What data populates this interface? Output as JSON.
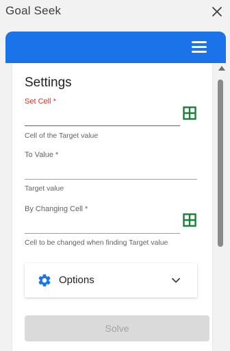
{
  "window": {
    "title": "Goal Seek",
    "close_icon": "close-icon"
  },
  "header": {
    "menu_icon": "hamburger-menu-icon",
    "color": "#1a73e8"
  },
  "settings": {
    "title": "Settings",
    "set_cell": {
      "label": "Set Cell *",
      "value": "",
      "helper": "Cell of the Target value",
      "picker_icon": "grid-select-icon"
    },
    "to_value": {
      "label": "To Value *",
      "value": "",
      "helper": "Target value"
    },
    "by_changing_cell": {
      "label": "By Changing Cell *",
      "value": "",
      "helper": "Cell to be changed when finding Target value",
      "picker_icon": "grid-select-icon"
    }
  },
  "options": {
    "label": "Options",
    "icon": "gear-icon",
    "expand_icon": "chevron-down-icon"
  },
  "solve": {
    "label": "Solve",
    "enabled": false
  },
  "colors": {
    "accent": "#1a73e8",
    "error": "#d93025",
    "grid_icon": "#188038"
  }
}
